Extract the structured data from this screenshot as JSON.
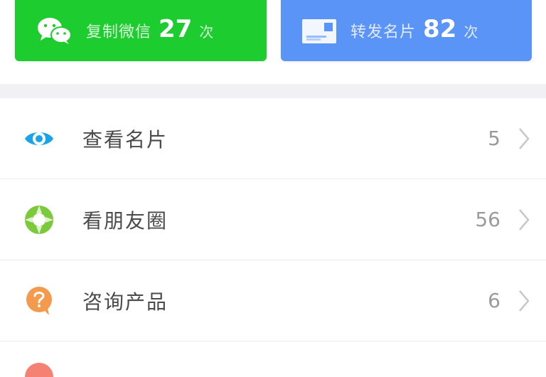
{
  "stats": [
    {
      "id": "wechat",
      "label": "复制微信",
      "count": "27",
      "unit": "次",
      "icon": "wechat-icon",
      "color": "#1dcc2f"
    },
    {
      "id": "forward",
      "label": "转发名片",
      "count": "82",
      "unit": "次",
      "icon": "business-card-icon",
      "color": "#5a94f7"
    }
  ],
  "list": {
    "items": [
      {
        "label": "查看名片",
        "count": "5",
        "icon": "eye-icon",
        "icon_color": "#1aa4e8"
      },
      {
        "label": "看朋友圈",
        "count": "56",
        "icon": "moments-icon",
        "icon_color": "#7cc93b"
      },
      {
        "label": "咨询产品",
        "count": "6",
        "icon": "question-bubble-icon",
        "icon_color": "#f39a4c"
      }
    ]
  },
  "colors": {
    "separator": "#f1f1f5",
    "label_text": "#4a4a4a",
    "count_text": "#9a9a9a",
    "chevron": "#c8c8c8"
  }
}
